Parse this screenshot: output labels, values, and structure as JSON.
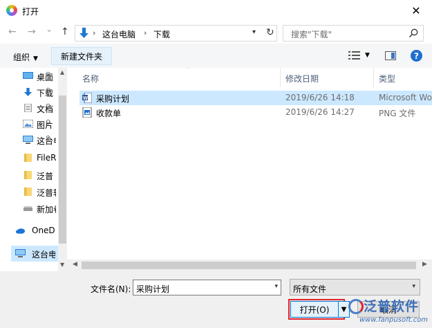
{
  "window": {
    "title": "打开",
    "close": "✕"
  },
  "nav": {
    "back": "←",
    "forward": "→",
    "dropdown": "⌄",
    "up": "↑",
    "path": [
      "这台电脑",
      "下载"
    ],
    "separator": "›",
    "refresh": "↻"
  },
  "search": {
    "placeholder": "搜索\"下载\""
  },
  "toolbar": {
    "organize": "组织",
    "new_folder": "新建文件夹",
    "help": "?"
  },
  "sidebar": {
    "items": [
      {
        "label": "桌面",
        "icon": "desktop-icon",
        "pinned": true
      },
      {
        "label": "下载",
        "icon": "download-arrow-icon",
        "pinned": true
      },
      {
        "label": "文档",
        "icon": "document-icon",
        "pinned": true
      },
      {
        "label": "图片",
        "icon": "pictures-icon",
        "pinned": true
      },
      {
        "label": "这台电脑",
        "icon": "computer-icon",
        "pinned": true
      },
      {
        "label": "FileRecv",
        "icon": "folder-icon",
        "pinned": false
      },
      {
        "label": "泛普",
        "icon": "folder-icon",
        "pinned": false
      },
      {
        "label": "泛普软件",
        "icon": "folder-icon",
        "pinned": false
      },
      {
        "label": "新加卷",
        "icon": "drive-icon",
        "pinned": false
      },
      {
        "label": "OneDrive",
        "icon": "onedrive-icon",
        "pinned": false
      },
      {
        "label": "这台电脑",
        "icon": "computer-icon",
        "pinned": false,
        "selected": true
      }
    ],
    "pin_glyph": "📌"
  },
  "columns": {
    "name": "名称",
    "date": "修改日期",
    "type": "类型"
  },
  "files": [
    {
      "name": "采购计划",
      "date": "2019/6/26 14:18",
      "type": "Microsoft Word",
      "icon": "word-doc-icon",
      "selected": true
    },
    {
      "name": "收款单",
      "date": "2019/6/26 14:27",
      "type": "PNG 文件",
      "icon": "png-image-icon",
      "selected": false
    }
  ],
  "bottom": {
    "filename_label": "文件名(N):",
    "filename_value": "采购计划",
    "filetype_value": "所有文件",
    "open_label": "打开(O)",
    "cancel_label": "取消"
  },
  "watermark": {
    "brand": "泛普软件",
    "url": "www.fanpusoft.com"
  },
  "colors": {
    "accent": "#0078d7",
    "selection": "#cce8ff",
    "highlight": "#e0242b"
  }
}
